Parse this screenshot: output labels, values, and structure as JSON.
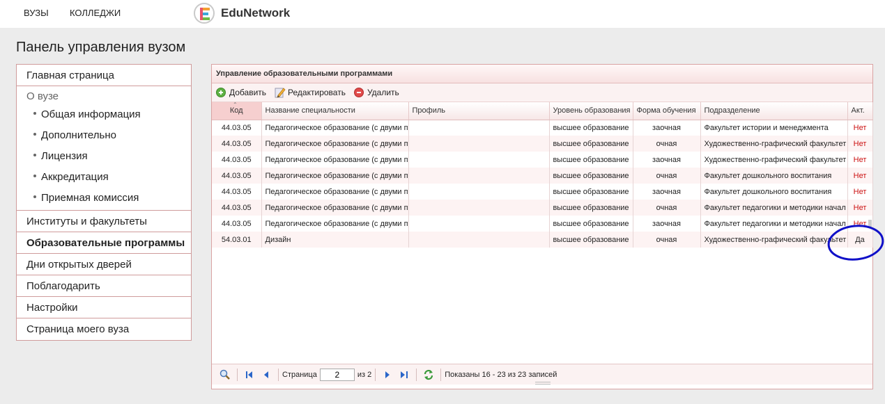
{
  "topnav": {
    "vuzy": "ВУЗЫ",
    "colleges": "КОЛЛЕДЖИ"
  },
  "logo": {
    "text": "EduNetwork"
  },
  "page_title": "Панель управления вузом",
  "sidebar": {
    "main": "Главная страница",
    "about_title": "О вузе",
    "about_items": [
      "Общая информация",
      "Дополнительно",
      "Лицензия",
      "Аккредитация",
      "Приемная комиссия"
    ],
    "items": [
      "Институты и факультеты",
      "Образовательные программы",
      "Дни открытых дверей",
      "Поблагодарить",
      "Настройки",
      "Страница моего вуза"
    ],
    "active": "Образовательные программы"
  },
  "panel": {
    "title": "Управление образовательными программами",
    "toolbar": {
      "add": "Добавить",
      "edit": "Редактировать",
      "delete": "Удалить"
    },
    "columns": [
      "Код",
      "Название специальности",
      "Профиль",
      "Уровень образования",
      "Форма обучения",
      "Подразделение",
      "Акт."
    ],
    "rows": [
      [
        "44.03.05",
        "Педагогическое образование (с двуми п",
        "",
        "высшее образование",
        "заочная",
        "Факультет истории и менеджмента",
        "Нет"
      ],
      [
        "44.03.05",
        "Педагогическое образование (с двуми п",
        "",
        "высшее образование",
        "очная",
        "Художественно-графический факультет",
        "Нет"
      ],
      [
        "44.03.05",
        "Педагогическое образование (с двуми п",
        "",
        "высшее образование",
        "заочная",
        "Художественно-графический факультет",
        "Нет"
      ],
      [
        "44.03.05",
        "Педагогическое образование (с двуми п",
        "",
        "высшее образование",
        "очная",
        "Факультет дошкольного воспитания",
        "Нет"
      ],
      [
        "44.03.05",
        "Педагогическое образование (с двуми п",
        "",
        "высшее образование",
        "заочная",
        "Факультет дошкольного воспитания",
        "Нет"
      ],
      [
        "44.03.05",
        "Педагогическое образование (с двуми п",
        "",
        "высшее образование",
        "очная",
        "Факультет педагогики и методики начал",
        "Нет"
      ],
      [
        "44.03.05",
        "Педагогическое образование (с двуми п",
        "",
        "высшее образование",
        "заочная",
        "Факультет педагогики и методики начал",
        "Нет"
      ],
      [
        "54.03.01",
        "Дизайн",
        "",
        "высшее образование",
        "очная",
        "Художественно-графический факультет",
        "Да"
      ]
    ],
    "pager": {
      "page_label": "Страница",
      "page_value": "2",
      "of_label": "из 2",
      "status": "Показаны 16 - 23 из 23 записей"
    }
  },
  "colors": {
    "accent_border": "#cf9b9b",
    "no_color": "#cc1111",
    "annotation": "#1010c8"
  }
}
